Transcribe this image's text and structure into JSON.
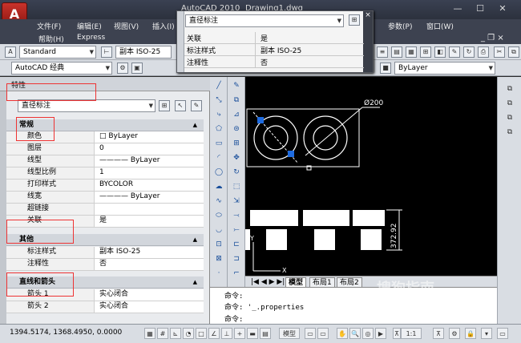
{
  "window": {
    "title": "AutoCAD 2010",
    "doc_title": "Drawing1.dwg",
    "app_logo": "A"
  },
  "menu": {
    "row1": [
      "文件(F)",
      "编辑(E)",
      "视图(V)",
      "插入(I)",
      "参数(P)",
      "窗口(W)"
    ],
    "row2": [
      "帮助(H)",
      "Express"
    ]
  },
  "toolbar1": {
    "text_style": "Standard",
    "dim_style": "副本 ISO-25"
  },
  "toolbar2": {
    "workspace": "AutoCAD 经典",
    "layer": "ByLayer"
  },
  "quick_props": {
    "type": "直径标注",
    "rows": [
      {
        "k": "关联",
        "v": "是"
      },
      {
        "k": "标注样式",
        "v": "副本 ISO-25"
      },
      {
        "k": "注释性",
        "v": "否"
      }
    ],
    "close": "×"
  },
  "palette": {
    "title": "特性",
    "selection": "直径标注",
    "cat_general": "常规",
    "general": [
      {
        "k": "颜色",
        "v": "□ ByLayer"
      },
      {
        "k": "图层",
        "v": "0"
      },
      {
        "k": "线型",
        "v": "———— ByLayer"
      },
      {
        "k": "线型比例",
        "v": "1"
      },
      {
        "k": "打印样式",
        "v": "BYCOLOR"
      },
      {
        "k": "线宽",
        "v": "———— ByLayer"
      },
      {
        "k": "超链接",
        "v": ""
      },
      {
        "k": "关联",
        "v": "是"
      }
    ],
    "cat_misc": "其他",
    "misc": [
      {
        "k": "标注样式",
        "v": "副本 ISO-25"
      },
      {
        "k": "注释性",
        "v": "否"
      }
    ],
    "cat_lines": "直线和箭头",
    "lines": [
      {
        "k": "箭头 1",
        "v": "实心闭合"
      },
      {
        "k": "箭头 2",
        "v": "实心闭合"
      }
    ]
  },
  "drawing": {
    "diameter_label": "Ø200",
    "vertical_dim": "372.92",
    "ucs_x": "X",
    "ucs_y": "Y"
  },
  "tabs": [
    "模型",
    "布局1",
    "布局2"
  ],
  "command": [
    "命令:",
    "命令: '_.properties",
    "命令:"
  ],
  "status": {
    "coords": "1394.5174,  1368.4950,  0.0000",
    "model": "模型",
    "scale": "1:1"
  },
  "watermark": {
    "cn": "搜狗指南",
    "en": "zhinan.sogou.com"
  }
}
